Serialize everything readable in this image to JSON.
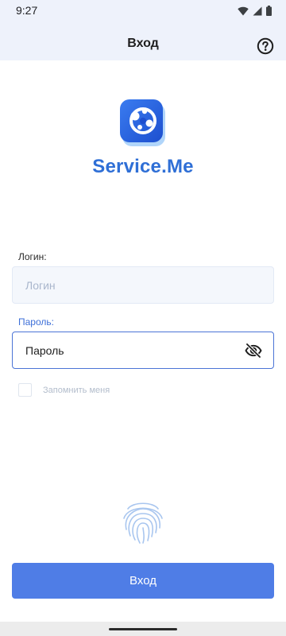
{
  "status_bar": {
    "time": "9:27",
    "icons": [
      "wifi-icon",
      "cellular-signal-icon",
      "battery-icon"
    ]
  },
  "app_bar": {
    "title": "Вход",
    "help_icon": "help-circle-icon"
  },
  "brand": {
    "name": "Service.Me",
    "logo_icon": "service-me-logo"
  },
  "form": {
    "login": {
      "label": "Логин:",
      "placeholder": "Логин",
      "value": ""
    },
    "password": {
      "label": "Пароль:",
      "value": "Пароль",
      "toggle_icon": "eye-off-icon",
      "focused": true
    },
    "remember": {
      "label": "Запомнить меня",
      "checked": false
    },
    "fingerprint_icon": "fingerprint-icon",
    "submit_label": "Вход"
  },
  "colors": {
    "accent": "#4f7de6",
    "brand_text": "#2f6fd6",
    "header_bg": "#eef2fb",
    "focused_border": "#4b74d6",
    "placeholder": "#a9b6cc"
  }
}
